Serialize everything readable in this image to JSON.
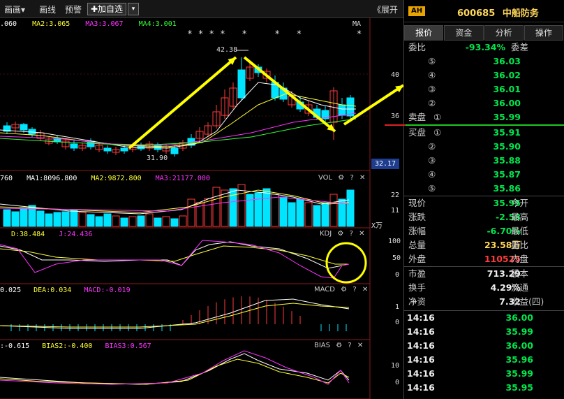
{
  "toolbar": {
    "draw": "画画▾",
    "line": "画线",
    "alert": "预警",
    "add_watch": "✚加自选",
    "dropdown": "▾",
    "expand": "《展开"
  },
  "ma_legend": {
    "ma1": ".060",
    "ma2": "MA2:3.065",
    "ma3": "MA3:3.067",
    "ma4": "MA4:3.001",
    "ma_tag": "MA",
    "stars": "* * * *   *     *   *          *"
  },
  "price_chart": {
    "high_label": "42.38",
    "low_label": "31.90",
    "y_ticks": [
      "40",
      "36"
    ],
    "current_tag": "32.17"
  },
  "vol_legend": {
    "vol0": "760",
    "ma1": "MA1:8096.800",
    "ma2": "MA2:9872.800",
    "ma3": "MA3:21177.000",
    "tag": "VOL",
    "y_ticks": [
      "22",
      "11"
    ],
    "unit": "X万"
  },
  "kdj_legend": {
    "d": "D:38.484",
    "j": "J:24.436",
    "tag": "KDJ",
    "y_ticks": [
      "100",
      "50",
      "0"
    ]
  },
  "macd_legend": {
    "diff": "0.025",
    "dea": "DEA:0.034",
    "macd": "MACD:-0.019",
    "tag": "MACD",
    "y_ticks": [
      "1",
      "0"
    ]
  },
  "bias_legend": {
    "bias1": ":-0.615",
    "bias2": "BIAS2:-0.400",
    "bias3": "BIAS3:0.567",
    "tag": "BIAS",
    "y_ticks": [
      "10",
      "0"
    ]
  },
  "panel_icons": {
    "gear": "⚙",
    "help": "?",
    "close": "✕"
  },
  "right_panel": {
    "badge": "AH",
    "code": "600685",
    "name": "中船防务",
    "tabs": [
      "报价",
      "资金",
      "分析",
      "操作"
    ],
    "weibi_label": "委比",
    "weibi_value": "-93.34%",
    "weicha_label": "委差",
    "asks": [
      {
        "level": "⑤",
        "price": "36.03"
      },
      {
        "level": "④",
        "price": "36.02"
      },
      {
        "level": "③",
        "price": "36.01"
      },
      {
        "level": "②",
        "price": "36.00"
      },
      {
        "level": "①",
        "price": "35.99",
        "label": "卖盘"
      }
    ],
    "bids": [
      {
        "level": "①",
        "price": "35.91",
        "label": "买盘"
      },
      {
        "level": "②",
        "price": "35.90"
      },
      {
        "level": "③",
        "price": "35.88"
      },
      {
        "level": "④",
        "price": "35.87"
      },
      {
        "level": "⑤",
        "price": "35.86"
      }
    ],
    "stats": [
      {
        "label": "现价",
        "value": "35.95",
        "label2": "今开",
        "color": "green"
      },
      {
        "label": "涨跌",
        "value": "-2.58",
        "label2": "最高",
        "color": "green"
      },
      {
        "label": "涨幅",
        "value": "-6.70%",
        "label2": "最低",
        "color": "green"
      },
      {
        "label": "总量",
        "value": "23.58万",
        "label2": "量比",
        "color": "yellow"
      },
      {
        "label": "外盘",
        "value": "110525",
        "label2": "内盘",
        "color": "red"
      }
    ],
    "stats2": [
      {
        "label": "市盈",
        "value": "713.29",
        "label2": "股本"
      },
      {
        "label": "换手",
        "value": "4.29%",
        "label2": "流通"
      },
      {
        "label": "净资",
        "value": "7.32",
        "label2": "收益(四)"
      }
    ],
    "ticks": [
      {
        "time": "14:16",
        "price": "36.00"
      },
      {
        "time": "14:16",
        "price": "35.99"
      },
      {
        "time": "14:16",
        "price": "36.00"
      },
      {
        "time": "14:16",
        "price": "35.96"
      },
      {
        "time": "14:16",
        "price": "35.99"
      },
      {
        "time": "14:16",
        "price": "35.95"
      }
    ]
  },
  "colors": {
    "up": "#ff3b3b",
    "down": "#00e5ff",
    "ma1": "#ffffff",
    "ma2": "#ffff33",
    "ma3": "#ff33ff",
    "ma4": "#33ff33",
    "annotation": "#ffff00"
  }
}
